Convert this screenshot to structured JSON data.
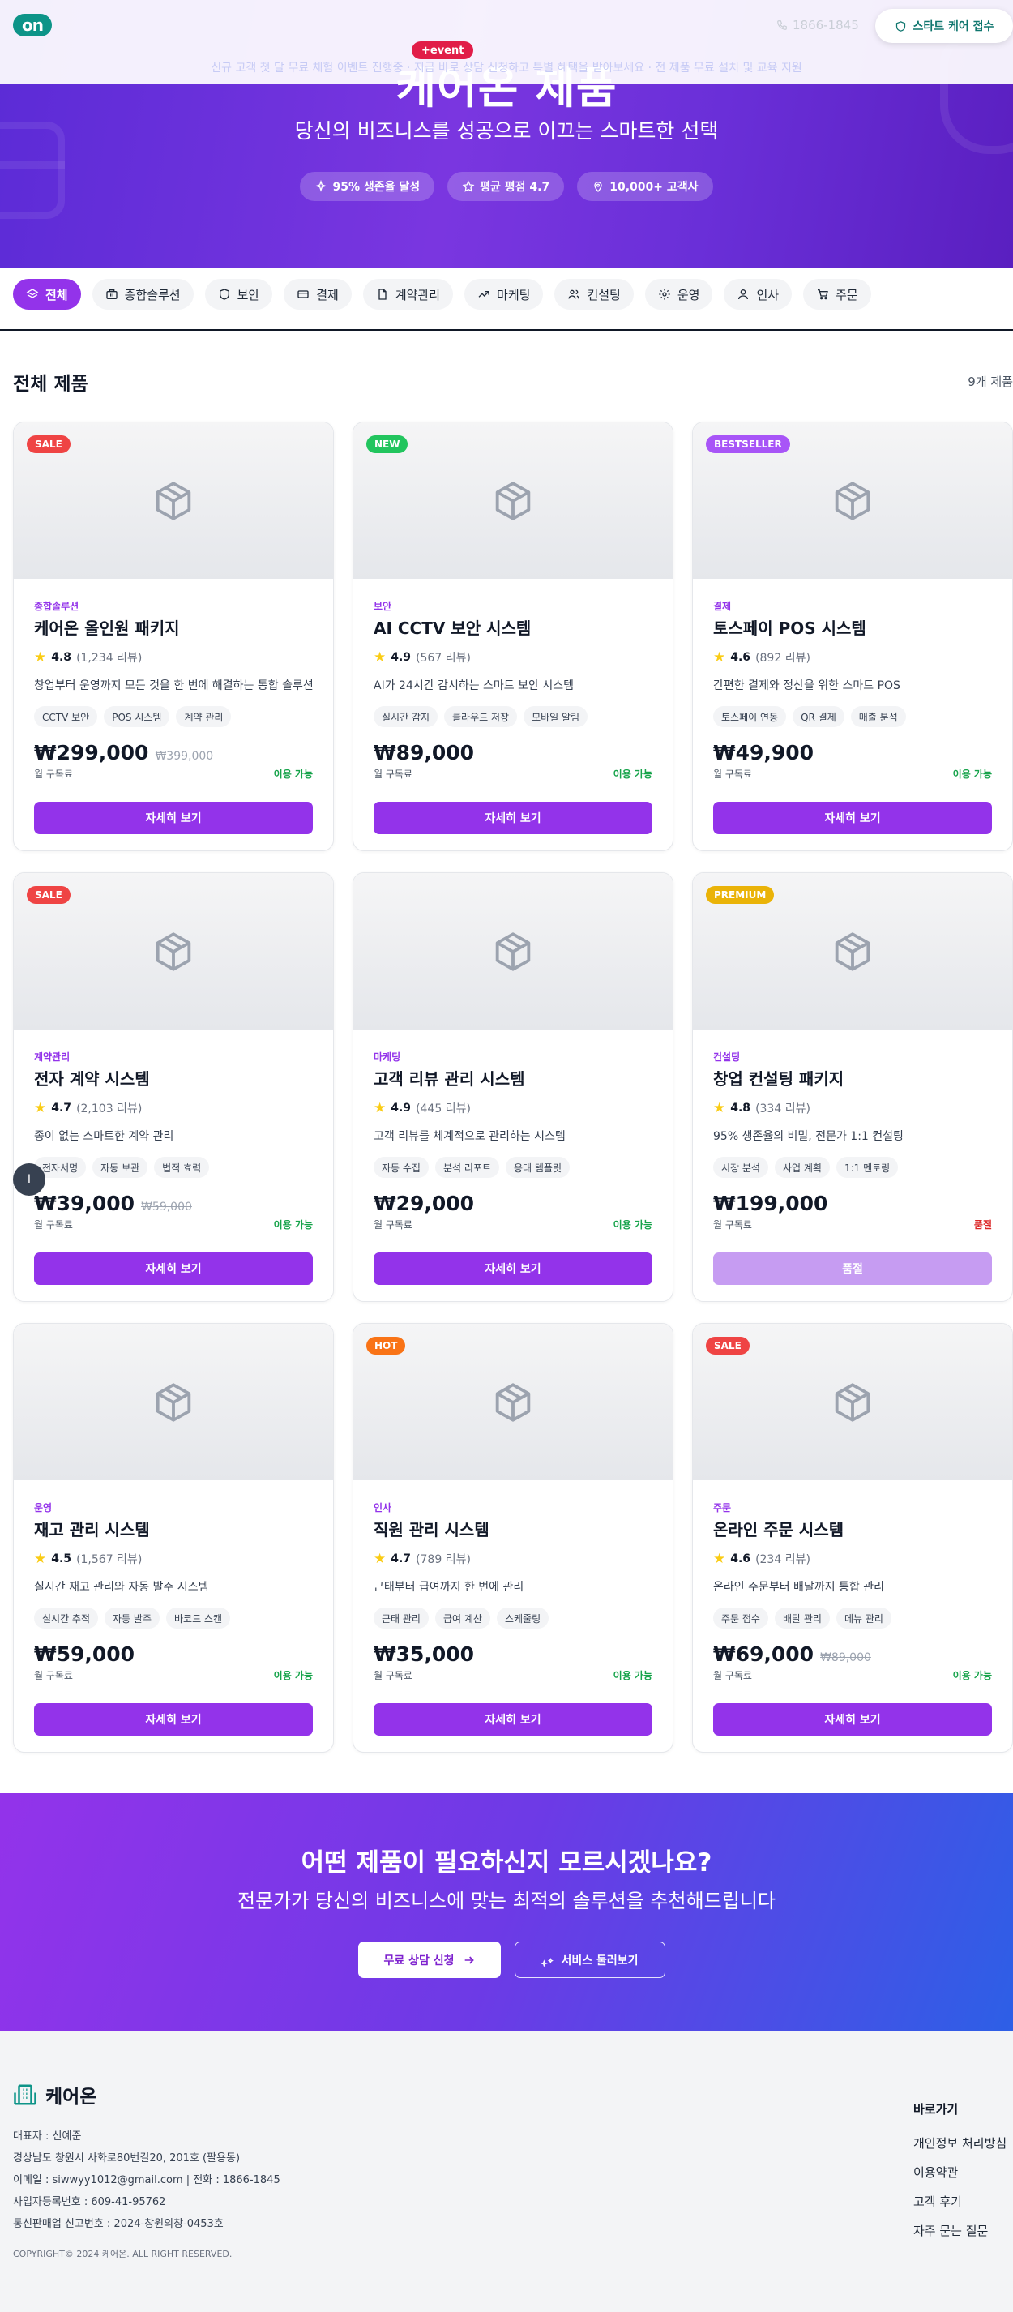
{
  "header": {
    "logo_text": "on",
    "phone": "1866-1845",
    "care_button": "스타트 케어 접수",
    "event_badge": "+event",
    "ticker": "신규 고객 첫 달 무료 체험 이벤트 진행중 · 지금 바로 상담 신청하고 특별 혜택을 받아보세요 · 전 제품 무료 설치 및 교육 지원"
  },
  "hero": {
    "title": "케어온 제품",
    "subtitle": "당신의 비즈니스를 성공으로 이끄는 스마트한 선택",
    "badges": [
      {
        "icon": "sparkle-icon",
        "label": "95% 생존율 달성"
      },
      {
        "icon": "star-outline-icon",
        "label": "평균 평점 4.7"
      },
      {
        "icon": "location-pin-icon",
        "label": "10,000+ 고객사"
      }
    ]
  },
  "categories": [
    {
      "icon": "grid-icon",
      "label": "전체",
      "active": true
    },
    {
      "icon": "package-icon",
      "label": "종합솔루션"
    },
    {
      "icon": "shield-icon",
      "label": "보안"
    },
    {
      "icon": "credit-card-icon",
      "label": "결제"
    },
    {
      "icon": "document-icon",
      "label": "계약관리"
    },
    {
      "icon": "trending-up-icon",
      "label": "마케팅"
    },
    {
      "icon": "users-icon",
      "label": "컨설팅"
    },
    {
      "icon": "gear-icon",
      "label": "운영"
    },
    {
      "icon": "user-icon",
      "label": "인사"
    },
    {
      "icon": "cart-icon",
      "label": "주문"
    }
  ],
  "section": {
    "title": "전체 제품",
    "count": "9개 제품"
  },
  "colors": {
    "accent": "#9333ea",
    "sale": "#ef4444",
    "new": "#22c55e",
    "bestseller": "#a855f7",
    "premium": "#eab308",
    "hot": "#f97316",
    "available": "#16a34a",
    "soldout": "#dc2626"
  },
  "products": [
    {
      "badge": "SALE",
      "badge_color": "#ef4444",
      "category": "종합솔루션",
      "title": "케어온 올인원 패키지",
      "rating": "4.8",
      "reviews": "(1,234 리뷰)",
      "desc": "창업부터 운영까지 모든 것을 한 번에 해결하는 통합 솔루션",
      "tags": [
        "CCTV 보안",
        "POS 시스템",
        "계약 관리"
      ],
      "price": "₩299,000",
      "old_price": "₩399,000",
      "period": "월 구독료",
      "status": "이용 가능",
      "sold_out": false,
      "button": "자세히 보기"
    },
    {
      "badge": "NEW",
      "badge_color": "#22c55e",
      "category": "보안",
      "title": "AI CCTV 보안 시스템",
      "rating": "4.9",
      "reviews": "(567 리뷰)",
      "desc": "AI가 24시간 감시하는 스마트 보안 시스템",
      "tags": [
        "실시간 감지",
        "클라우드 저장",
        "모바일 알림"
      ],
      "price": "₩89,000",
      "old_price": "",
      "period": "월 구독료",
      "status": "이용 가능",
      "sold_out": false,
      "button": "자세히 보기"
    },
    {
      "badge": "BESTSELLER",
      "badge_color": "#a855f7",
      "category": "결제",
      "title": "토스페이 POS 시스템",
      "rating": "4.6",
      "reviews": "(892 리뷰)",
      "desc": "간편한 결제와 정산을 위한 스마트 POS",
      "tags": [
        "토스페이 연동",
        "QR 결제",
        "매출 분석"
      ],
      "price": "₩49,900",
      "old_price": "",
      "period": "월 구독료",
      "status": "이용 가능",
      "sold_out": false,
      "button": "자세히 보기"
    },
    {
      "badge": "SALE",
      "badge_color": "#ef4444",
      "category": "계약관리",
      "title": "전자 계약 시스템",
      "rating": "4.7",
      "reviews": "(2,103 리뷰)",
      "desc": "종이 없는 스마트한 계약 관리",
      "tags": [
        "전자서명",
        "자동 보관",
        "법적 효력"
      ],
      "price": "₩39,000",
      "old_price": "₩59,000",
      "period": "월 구독료",
      "status": "이용 가능",
      "sold_out": false,
      "button": "자세히 보기"
    },
    {
      "badge": "",
      "badge_color": "",
      "category": "마케팅",
      "title": "고객 리뷰 관리 시스템",
      "rating": "4.9",
      "reviews": "(445 리뷰)",
      "desc": "고객 리뷰를 체계적으로 관리하는 시스템",
      "tags": [
        "자동 수집",
        "분석 리포트",
        "응대 템플릿"
      ],
      "price": "₩29,000",
      "old_price": "",
      "period": "월 구독료",
      "status": "이용 가능",
      "sold_out": false,
      "button": "자세히 보기"
    },
    {
      "badge": "PREMIUM",
      "badge_color": "#eab308",
      "category": "컨설팅",
      "title": "창업 컨설팅 패키지",
      "rating": "4.8",
      "reviews": "(334 리뷰)",
      "desc": "95% 생존율의 비밀, 전문가 1:1 컨설팅",
      "tags": [
        "시장 분석",
        "사업 계획",
        "1:1 멘토링"
      ],
      "price": "₩199,000",
      "old_price": "",
      "period": "월 구독료",
      "status": "품절",
      "sold_out": true,
      "button": "품절"
    },
    {
      "badge": "",
      "badge_color": "",
      "category": "운영",
      "title": "재고 관리 시스템",
      "rating": "4.5",
      "reviews": "(1,567 리뷰)",
      "desc": "실시간 재고 관리와 자동 발주 시스템",
      "tags": [
        "실시간 추적",
        "자동 발주",
        "바코드 스캔"
      ],
      "price": "₩59,000",
      "old_price": "",
      "period": "월 구독료",
      "status": "이용 가능",
      "sold_out": false,
      "button": "자세히 보기"
    },
    {
      "badge": "HOT",
      "badge_color": "#f97316",
      "category": "인사",
      "title": "직원 관리 시스템",
      "rating": "4.7",
      "reviews": "(789 리뷰)",
      "desc": "근태부터 급여까지 한 번에 관리",
      "tags": [
        "근태 관리",
        "급여 계산",
        "스케줄링"
      ],
      "price": "₩35,000",
      "old_price": "",
      "period": "월 구독료",
      "status": "이용 가능",
      "sold_out": false,
      "button": "자세히 보기"
    },
    {
      "badge": "SALE",
      "badge_color": "#ef4444",
      "category": "주문",
      "title": "온라인 주문 시스템",
      "rating": "4.6",
      "reviews": "(234 리뷰)",
      "desc": "온라인 주문부터 배달까지 통합 관리",
      "tags": [
        "주문 접수",
        "배달 관리",
        "메뉴 관리"
      ],
      "price": "₩69,000",
      "old_price": "₩89,000",
      "period": "월 구독료",
      "status": "이용 가능",
      "sold_out": false,
      "button": "자세히 보기"
    }
  ],
  "float_button": "I",
  "cta": {
    "heading": "어떤 제품이 필요하신지 모르시겠나요?",
    "subheading": "전문가가 당신의 비즈니스에 맞는 최적의 솔루션을 추천해드립니다",
    "primary_button": "무료 상담 신청",
    "secondary_button": "서비스 둘러보기"
  },
  "footer": {
    "brand": "케어온",
    "lines": [
      "대표자 : 신예준",
      "경상남도 창원시 사화로80번길20, 201호 (팔용동)",
      "이메일 : siwwyy1012@gmail.com | 전화 : 1866-1845",
      "사업자등록번호 : 609-41-95762",
      "통신판매업 신고번호 : 2024-창원의창-0453호"
    ],
    "copyright": "COPYRIGHT© 2024 케어온. ALL RIGHT RESERVED.",
    "quick_title": "바로가기",
    "links": [
      "개인정보 처리방침",
      "이용약관",
      "고객 후기",
      "자주 묻는 질문"
    ]
  }
}
